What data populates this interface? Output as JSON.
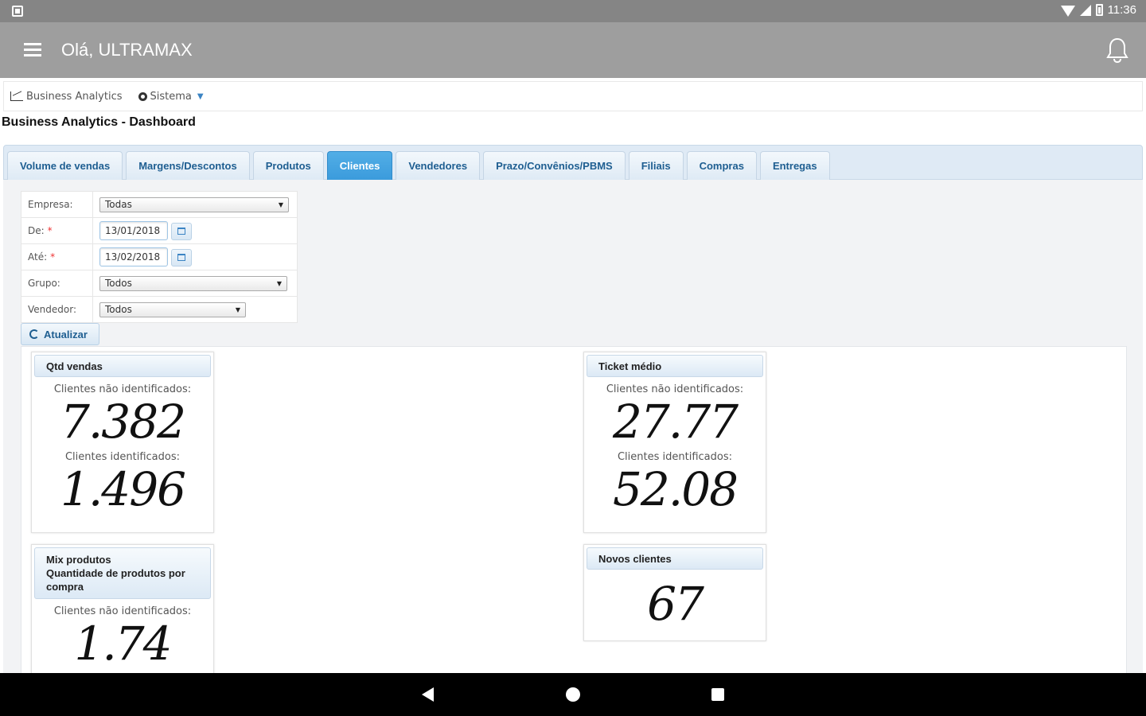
{
  "status_bar": {
    "time": "11:36"
  },
  "app_bar": {
    "title": "Olá, ULTRAMAX"
  },
  "menu": {
    "business_analytics": "Business Analytics",
    "sistema": "Sistema"
  },
  "page_title": "Business Analytics - Dashboard",
  "tabs": [
    {
      "label": "Volume de vendas",
      "active": false
    },
    {
      "label": "Margens/Descontos",
      "active": false
    },
    {
      "label": "Produtos",
      "active": false
    },
    {
      "label": "Clientes",
      "active": true
    },
    {
      "label": "Vendedores",
      "active": false
    },
    {
      "label": "Prazo/Convênios/PBMS",
      "active": false
    },
    {
      "label": "Filiais",
      "active": false
    },
    {
      "label": "Compras",
      "active": false
    },
    {
      "label": "Entregas",
      "active": false
    }
  ],
  "filters": {
    "empresa": {
      "label": "Empresa:",
      "value": "Todas"
    },
    "de": {
      "label": "De:",
      "value": "13/01/2018"
    },
    "ate": {
      "label": "Até:",
      "value": "13/02/2018"
    },
    "grupo": {
      "label": "Grupo:",
      "value": "Todos"
    },
    "vendedor": {
      "label": "Vendedor:",
      "value": "Todos"
    },
    "required_mark": "*",
    "refresh_label": "Atualizar"
  },
  "cards": {
    "qtd_vendas": {
      "title": "Qtd vendas",
      "label_nao_ident": "Clientes não identificados:",
      "value_nao_ident": "7.382",
      "label_ident": "Clientes identificados:",
      "value_ident": "1.496"
    },
    "ticket_medio": {
      "title": "Ticket médio",
      "label_nao_ident": "Clientes não identificados:",
      "value_nao_ident": "27.77",
      "label_ident": "Clientes identificados:",
      "value_ident": "52.08"
    },
    "mix_produtos": {
      "title_line1": "Mix produtos",
      "title_line2": "Quantidade de produtos por compra",
      "label_nao_ident": "Clientes não identificados:",
      "value_nao_ident": "1.74"
    },
    "novos_clientes": {
      "title": "Novos clientes",
      "value": "67"
    }
  },
  "colors": {
    "status_bar": "#858585",
    "app_bar": "#9e9e9e",
    "tab_active": "#3b9bdc",
    "tab_text": "#1e5e91"
  }
}
